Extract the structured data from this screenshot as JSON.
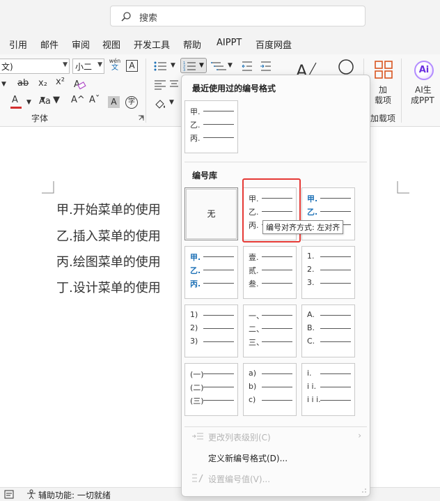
{
  "search": {
    "placeholder": "搜索"
  },
  "menu_tabs": [
    "引用",
    "邮件",
    "审阅",
    "视图",
    "开发工具",
    "帮助",
    "AIPPT",
    "百度网盘"
  ],
  "ribbon": {
    "font_name": "文)",
    "font_size": "小二",
    "phonetic_top": "wén",
    "phonetic_bottom": "文",
    "border_char": "A",
    "strike": "ab",
    "subscript": "x₂",
    "superscript": "x²",
    "font_color": "A",
    "grow": "A^",
    "shrink": "Aˇ",
    "case": "Aa",
    "shade": "A",
    "enclose": "字",
    "font_group_label": "字体",
    "addins_label_1": "加",
    "addins_label_2": "载项",
    "addins_group_label": "加载项",
    "ai_icon": "Ai",
    "ai_label_1": "AI生",
    "ai_label_2": "成PPT"
  },
  "document": {
    "lines": [
      "甲.开始菜单的使用",
      "乙.插入菜单的使用",
      "丙.绘图菜单的使用",
      "丁.设计菜单的使用"
    ]
  },
  "status": {
    "accessibility": "辅助功能: 一切就绪"
  },
  "dropdown": {
    "recent_title": "最近使用过的编号格式",
    "recent_tile": [
      "甲.",
      "乙.",
      "丙."
    ],
    "library_title": "编号库",
    "none_label": "无",
    "tiles": [
      {
        "rows": [
          "甲.",
          "乙.",
          "丙."
        ],
        "style": "normal"
      },
      {
        "rows": [
          "甲.",
          "乙.",
          "丙."
        ],
        "style": "blue-partial"
      },
      {
        "rows": [
          "甲.",
          "乙.",
          "丙."
        ],
        "style": "blue"
      },
      {
        "rows": [
          "壹.",
          "贰.",
          "叁."
        ],
        "style": "normal"
      },
      {
        "rows": [
          "1.",
          "2.",
          "3."
        ],
        "style": "normal"
      },
      {
        "rows": [
          "1)",
          "2)",
          "3)"
        ],
        "style": "normal"
      },
      {
        "rows": [
          "一、",
          "二、",
          "三、"
        ],
        "style": "normal"
      },
      {
        "rows": [
          "A.",
          "B.",
          "C."
        ],
        "style": "normal"
      },
      {
        "rows": [
          "(一)",
          "(二)",
          "(三)"
        ],
        "style": "normal"
      },
      {
        "rows": [
          "a)",
          "b)",
          "c)"
        ],
        "style": "normal"
      },
      {
        "rows": [
          "i.",
          "i i.",
          "i i i."
        ],
        "style": "normal"
      }
    ],
    "tooltip": "编号对齐方式: 左对齐",
    "menu": {
      "change_level": "更改列表级别(C)",
      "define_new": "定义新编号格式(D)...",
      "set_value": "设置编号值(V)..."
    }
  },
  "colors": {
    "accent_blue": "#1a6fb5",
    "highlight_red": "#e53935",
    "addins_orange": "#d9541e"
  }
}
